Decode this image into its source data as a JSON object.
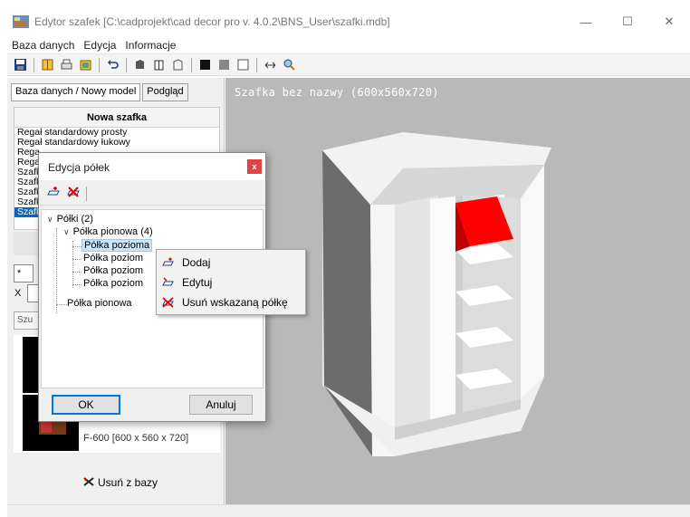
{
  "window": {
    "title": "Edytor szafek [C:\\cadprojekt\\cad decor pro v. 4.0.2\\BNS_User\\szafki.mdb]",
    "minimize": "—",
    "maximize": "☐",
    "close": "✕"
  },
  "menu": [
    "Baza danych",
    "Edycja",
    "Informacje"
  ],
  "left_panel": {
    "tab_active": "Baza danych / Nowy model",
    "tab_inactive": "Podgląd",
    "list_header": "Nowa szafka",
    "list_items": [
      "Regał standardowy prosty",
      "Regał standardowy łukowy",
      "Rega",
      "Rega",
      "Szafk",
      "Szafk",
      "Szafk",
      "Szafk",
      "Szafk"
    ],
    "selected_index": 8,
    "search_value": "*",
    "x_label": "X",
    "search_button": "Szu",
    "thumb_label": "F-600  [600 x 560 x 720]",
    "delete_button": "Usuń z bazy"
  },
  "viewport": {
    "title": "Szafka bez nazwy (600x560x720)",
    "highlight_color": "#ff0000",
    "background": "#b9b9b9"
  },
  "dialog": {
    "title": "Edycja półek",
    "close": "x",
    "tree": {
      "root": "Półki (2)",
      "vertical1": "Półka pionowa (4)",
      "children": [
        "Półka pozioma",
        "Półka poziom",
        "Półka poziom",
        "Półka poziom"
      ],
      "vertical2": "Półka pionowa"
    },
    "ok": "OK",
    "cancel": "Anuluj"
  },
  "context_menu": {
    "items": [
      "Dodaj",
      "Edytuj",
      "Usuń wskazaną półkę"
    ]
  }
}
